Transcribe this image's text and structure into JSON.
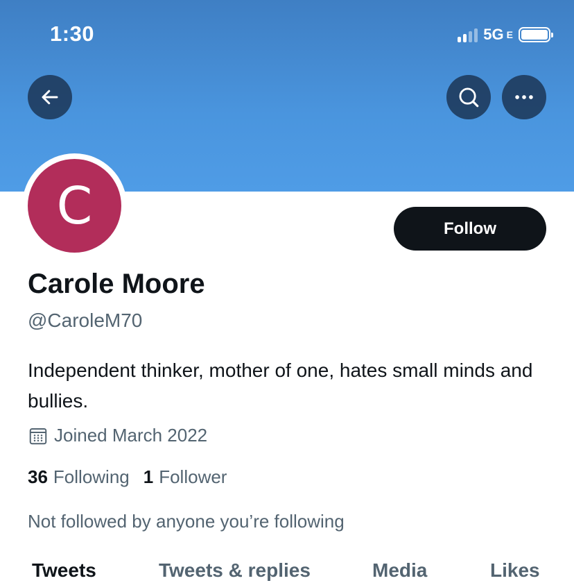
{
  "status_bar": {
    "time": "1:30",
    "network": "5G",
    "network_suffix": "E",
    "signal_bars": 4,
    "signal_active": 2
  },
  "header": {
    "back_icon": "arrow-left-icon",
    "search_icon": "search-icon",
    "more_icon": "more-horizontal-icon",
    "banner_color": "#4a95de"
  },
  "profile": {
    "avatar_letter": "C",
    "avatar_color": "#b22d5a",
    "name": "Carole Moore",
    "handle": "@CaroleM70",
    "bio": "Independent thinker, mother of one, hates small minds and bullies.",
    "joined": "Joined March 2022",
    "joined_icon": "calendar-icon",
    "following_count": "36",
    "following_label": "Following",
    "followers_count": "1",
    "followers_label": "Follower",
    "not_followed_text": "Not followed by anyone you’re following"
  },
  "follow_button": {
    "label": "Follow"
  },
  "tabs": [
    {
      "label": "Tweets",
      "active": true
    },
    {
      "label": "Tweets & replies",
      "active": false
    },
    {
      "label": "Media",
      "active": false
    },
    {
      "label": "Likes",
      "active": false
    }
  ]
}
